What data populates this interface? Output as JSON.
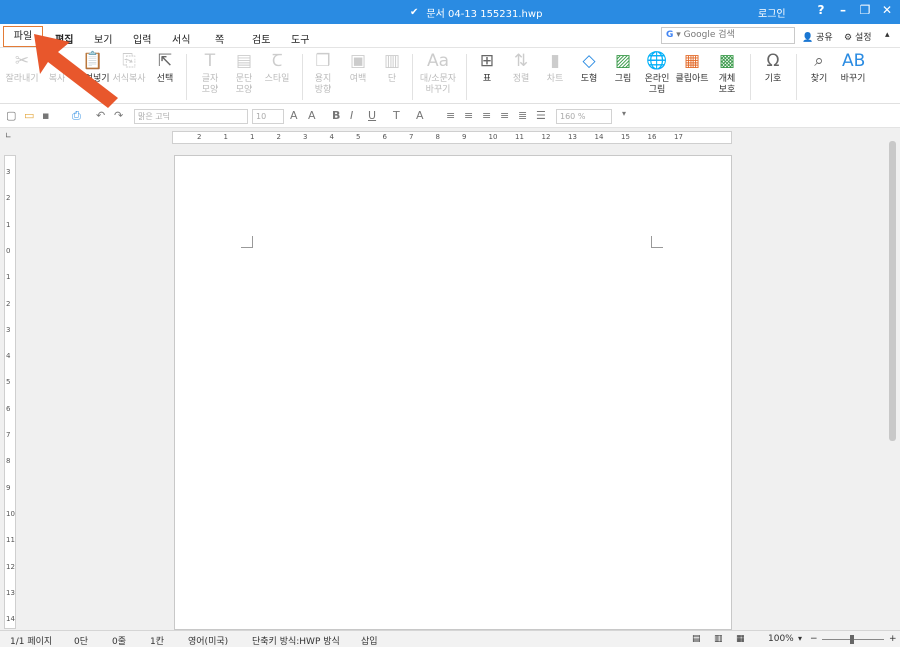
{
  "window": {
    "title": "문서 04-13 155231.hwp",
    "login": "로그인",
    "help": "?",
    "minimize": "–",
    "restore": "❐",
    "close": "✕"
  },
  "menu": {
    "items": [
      "파일",
      "편집",
      "보기",
      "입력",
      "서식",
      "쪽",
      "검토",
      "도구"
    ],
    "search_placeholder": "Google 검색",
    "share": "공유",
    "settings": "설정"
  },
  "ribbon": {
    "cut": "잘라내기",
    "copy": "복사",
    "paste": "붙여넣기",
    "format_copy": "서식복사",
    "select": "선택",
    "char_shape_1": "글자",
    "char_shape_2": "모양",
    "para_shape_1": "문단",
    "para_shape_2": "모양",
    "style": "스타일",
    "paper_1": "용지",
    "paper_2": "방향",
    "margin": "여백",
    "column": "단",
    "case_1": "대/소문자",
    "case_2": "바꾸기",
    "table": "표",
    "sort": "정렬",
    "chart": "차트",
    "shape": "도형",
    "picture": "그림",
    "online_pic_1": "온라인",
    "online_pic_2": "그림",
    "clipart": "클립아트",
    "protect_1": "개체",
    "protect_2": "보호",
    "symbol": "기호",
    "find": "찾기",
    "replace": "바꾸기"
  },
  "toolbar": {
    "font": "맑은 고딕",
    "size": "10",
    "zoom": "160 %"
  },
  "ruler": {
    "h_ticks": [
      "2",
      "1",
      "1",
      "2",
      "3",
      "4",
      "5",
      "6",
      "7",
      "8",
      "9",
      "10",
      "11",
      "12",
      "13",
      "14",
      "15",
      "16",
      "17"
    ],
    "v_ticks": [
      "3",
      "2",
      "1",
      "0",
      "1",
      "2",
      "3",
      "4",
      "5",
      "6",
      "7",
      "8",
      "9",
      "10",
      "11",
      "12",
      "13",
      "14"
    ]
  },
  "status": {
    "page": "1/1 페이지",
    "section": "0단",
    "line": "0줄",
    "col": "1칸",
    "lang": "영어(미국)",
    "shortcut": "단축키 방식:HWP 방식",
    "insert": "삽입",
    "zoom": "100%"
  }
}
